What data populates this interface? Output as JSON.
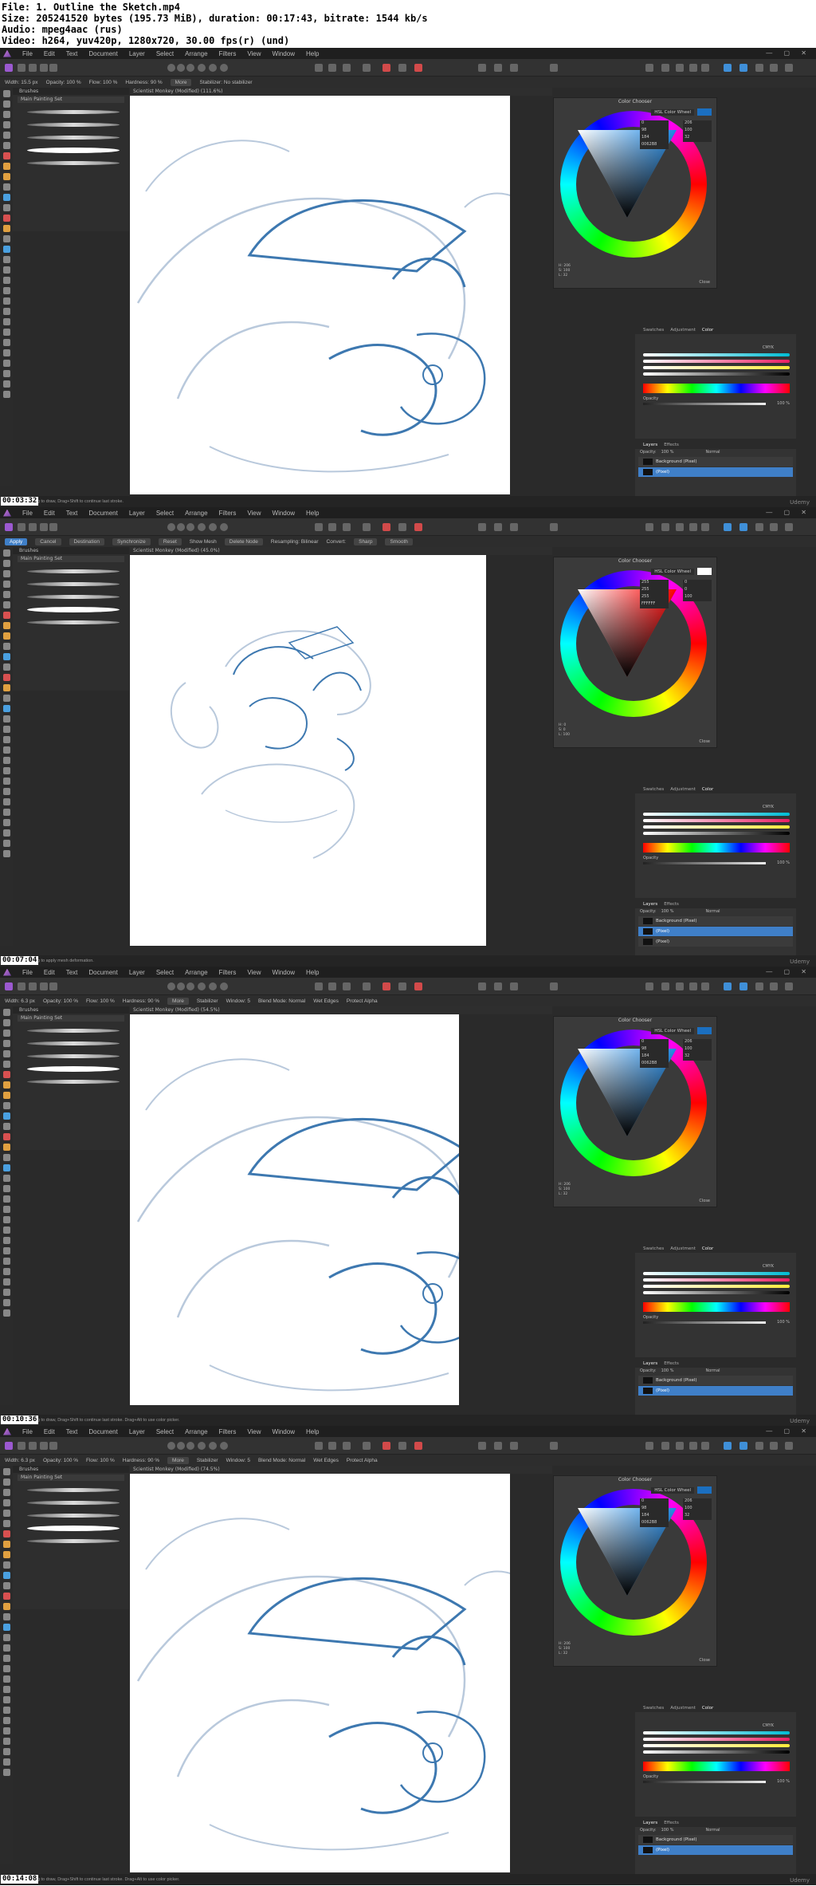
{
  "file_info": {
    "line1": "File: 1. Outline the Sketch.mp4",
    "line2": "Size: 205241520 bytes (195.73 MiB), duration: 00:17:43, bitrate: 1544 kb/s",
    "line3": "Audio: mpeg4aac (rus)",
    "line4": "Video: h264, yuv420p, 1280x720, 30.00 fps(r) (und)"
  },
  "menu": [
    "File",
    "Edit",
    "Text",
    "Document",
    "Layer",
    "Select",
    "Arrange",
    "Filters",
    "View",
    "Window",
    "Help"
  ],
  "brushes_panel": {
    "header": "Brushes",
    "set": "Main Painting Set"
  },
  "color_chooser": {
    "title": "Color Chooser",
    "mode": "HSL Color Wheel",
    "close": "Close"
  },
  "color_tabs": [
    "Swatches",
    "Adjustment",
    "Color"
  ],
  "color_mode": "CMYK",
  "opacity_label": "Opacity",
  "opacity_value": "100 %",
  "layers_tabs": [
    "Layers",
    "Effects"
  ],
  "layers_ctl": {
    "opacity": "Opacity:",
    "opacity_value": "100 %",
    "blend": "Normal"
  },
  "frames": [
    {
      "timestamp": "00:03:32",
      "status": "Drag to draw, Drag+Shift to continue last stroke.",
      "ctx": [
        "Width: 15.5 px",
        "Opacity: 100 %",
        "Flow: 100 %",
        "Hardness: 90 %",
        "More",
        "Stabilizer: No stabilizer"
      ],
      "doc_title": "Scientist Monkey (Modified) (111.6%)",
      "swatch_color": "#1b6fc0",
      "values": {
        "H": "206",
        "S": "100",
        "L": "32",
        "R": "0",
        "G": "98",
        "B": "184",
        "HEX": "0062B8"
      },
      "hsl": "H: 206\nS: 100\nL: 32",
      "layers": [
        {
          "name": "Background (Pixel)",
          "sel": false
        },
        {
          "name": "(Pixel)",
          "sel": true
        }
      ]
    },
    {
      "timestamp": "00:07:04",
      "status": "Drag to apply mesh deformation.",
      "ctx": [
        "Apply",
        "Cancel",
        "Destination",
        "Synchronize",
        "Reset",
        "Show Mesh",
        "Delete Node",
        "Resampling: Bilinear",
        "Convert:",
        "Sharp",
        "Smooth"
      ],
      "doc_title": "Scientist Monkey (Modified) (45.0%)",
      "swatch_color": "#ffffff",
      "values": {
        "H": "0",
        "S": "0",
        "L": "100",
        "R": "255",
        "G": "255",
        "B": "255",
        "HEX": "FFFFFF"
      },
      "hsl": "H: 0\nS: 0\nL: 100",
      "layers": [
        {
          "name": "Background (Pixel)",
          "sel": false
        },
        {
          "name": "(Pixel)",
          "sel": true
        },
        {
          "name": "(Pixel)",
          "sel": false
        }
      ]
    },
    {
      "timestamp": "00:10:36",
      "status": "Drag to draw, Drag+Shift to continue last stroke. Drag+Alt to use color picker.",
      "ctx": [
        "Width: 6.3 px",
        "Opacity: 100 %",
        "Flow: 100 %",
        "Hardness: 90 %",
        "More",
        "Stabilizer",
        "Window: 5",
        "Blend Mode: Normal",
        "Wet Edges",
        "Protect Alpha"
      ],
      "doc_title": "Scientist Monkey (Modified) (54.5%)",
      "swatch_color": "#1b6fc0",
      "values": {
        "H": "206",
        "S": "100",
        "L": "32",
        "R": "0",
        "G": "98",
        "B": "184",
        "HEX": "0062B8"
      },
      "hsl": "H: 206\nS: 100\nL: 32",
      "layers": [
        {
          "name": "Background (Pixel)",
          "sel": false
        },
        {
          "name": "(Pixel)",
          "sel": true
        }
      ]
    },
    {
      "timestamp": "00:14:08",
      "status": "Drag to draw, Drag+Shift to continue last stroke. Drag+Alt to use color picker.",
      "ctx": [
        "Width: 6.3 px",
        "Opacity: 100 %",
        "Flow: 100 %",
        "Hardness: 90 %",
        "More",
        "Stabilizer",
        "Window: 5",
        "Blend Mode: Normal",
        "Wet Edges",
        "Protect Alpha"
      ],
      "doc_title": "Scientist Monkey (Modified) (74.5%)",
      "swatch_color": "#1b6fc0",
      "values": {
        "H": "206",
        "S": "100",
        "L": "32",
        "R": "0",
        "G": "98",
        "B": "184",
        "HEX": "0062B8"
      },
      "hsl": "H: 206\nS: 100\nL: 32",
      "layers": [
        {
          "name": "Background (Pixel)",
          "sel": false
        },
        {
          "name": "(Pixel)",
          "sel": true
        }
      ]
    }
  ],
  "watermark": "Udemy"
}
